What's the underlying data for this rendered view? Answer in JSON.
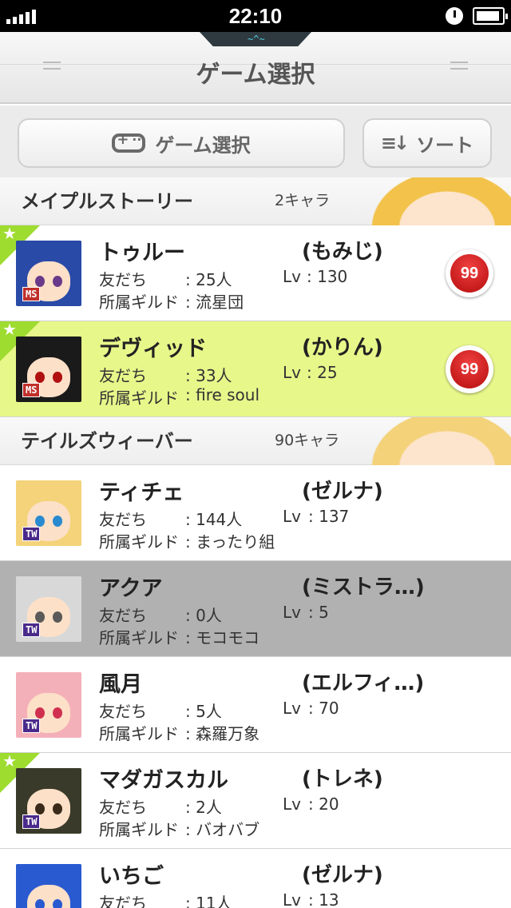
{
  "status_bar": {
    "time": "22:10"
  },
  "header": {
    "title": "ゲーム選択"
  },
  "toolbar": {
    "game_select_label": "ゲーム選択",
    "sort_label": "ソート"
  },
  "sections": [
    {
      "title": "メイプルストーリー",
      "count": "2キャラ",
      "characters": [
        {
          "name": "トゥルー",
          "server": "(もみじ)",
          "friends_label": "友だち",
          "friends_value": ": 25人",
          "lv_label": "Lv",
          "lv_value": ": 130",
          "guild_label": "所属ギルド",
          "guild_value": ": 流星団",
          "game_badge": "MS",
          "badge_count": "99",
          "starred": true,
          "selected": "none"
        },
        {
          "name": "デヴィッド",
          "server": "(かりん)",
          "friends_label": "友だち",
          "friends_value": ": 33人",
          "lv_label": "Lv",
          "lv_value": ": 25",
          "guild_label": "所属ギルド",
          "guild_value": ": fire soul",
          "game_badge": "MS",
          "badge_count": "99",
          "starred": true,
          "selected": "green"
        }
      ]
    },
    {
      "title": "テイルズウィーバー",
      "count": "90キャラ",
      "characters": [
        {
          "name": "ティチェ",
          "server": "(ゼルナ)",
          "friends_label": "友だち",
          "friends_value": ": 144人",
          "lv_label": "Lv",
          "lv_value": ": 137",
          "guild_label": "所属ギルド",
          "guild_value": ": まったり組",
          "game_badge": "TW",
          "starred": false,
          "selected": "none"
        },
        {
          "name": "アクア",
          "server": "(ミストラ…)",
          "friends_label": "友だち",
          "friends_value": ": 0人",
          "lv_label": "Lv",
          "lv_value": ": 5",
          "guild_label": "所属ギルド",
          "guild_value": ": モコモコ",
          "game_badge": "TW",
          "starred": false,
          "selected": "gray"
        },
        {
          "name": "風月",
          "server": "(エルフィ…)",
          "friends_label": "友だち",
          "friends_value": ": 5人",
          "lv_label": "Lv",
          "lv_value": ": 70",
          "guild_label": "所属ギルド",
          "guild_value": ": 森羅万象",
          "game_badge": "TW",
          "starred": false,
          "selected": "none"
        },
        {
          "name": "マダガスカル",
          "server": "(トレネ)",
          "friends_label": "友だち",
          "friends_value": ": 2人",
          "lv_label": "Lv",
          "lv_value": ": 20",
          "guild_label": "所属ギルド",
          "guild_value": ": バオバブ",
          "game_badge": "TW",
          "starred": true,
          "selected": "none"
        },
        {
          "name": "いちご",
          "server": "(ゼルナ)",
          "friends_label": "友だち",
          "friends_value": ": 11人",
          "lv_label": "Lv",
          "lv_value": ": 13",
          "guild_label": "所属ギルド",
          "guild_value": "",
          "game_badge": "TW",
          "starred": false,
          "selected": "none"
        }
      ]
    }
  ],
  "colors": {
    "selected_green": "#e8f78a",
    "selected_gray": "#b1b1b1",
    "star_tab": "#9edc30",
    "badge_red": "#d01818"
  }
}
